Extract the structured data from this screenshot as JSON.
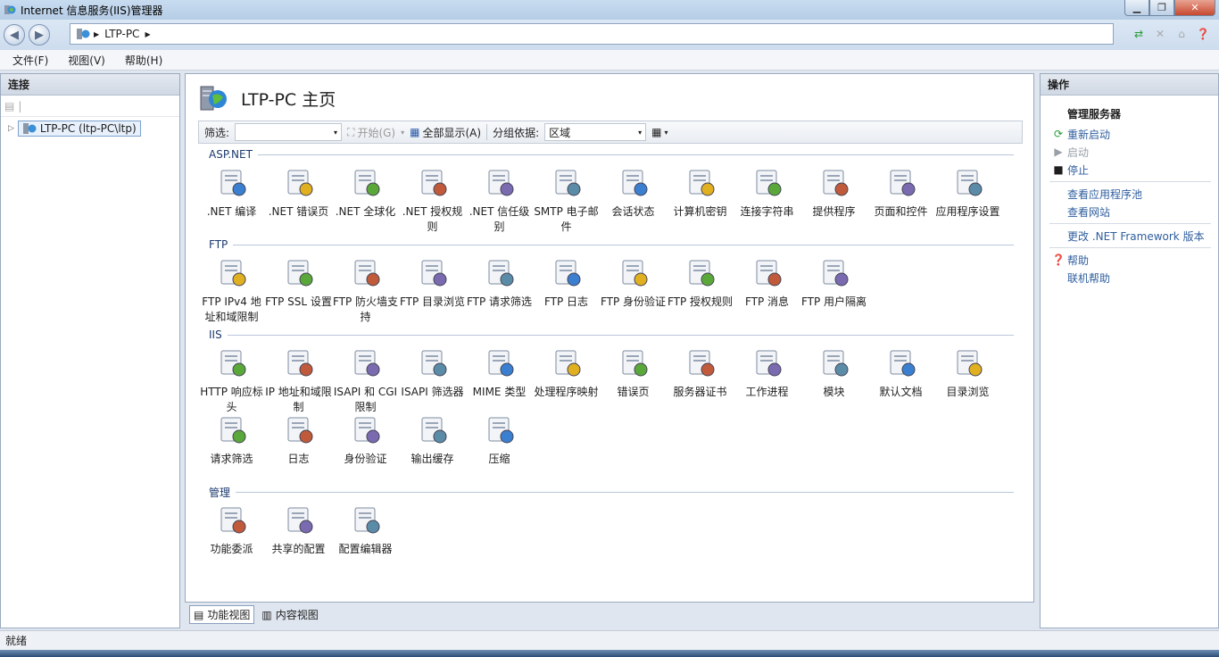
{
  "window": {
    "title": "Internet 信息服务(IIS)管理器"
  },
  "address": {
    "crumb": "LTP-PC"
  },
  "menu": [
    "文件(F)",
    "视图(V)",
    "帮助(H)"
  ],
  "left": {
    "header": "连接",
    "tree_node": "LTP-PC (ltp-PC\\ltp)"
  },
  "main": {
    "title": "LTP-PC 主页",
    "filter_label": "筛选:",
    "start_label": "开始(G)",
    "show_all_label": "全部显示(A)",
    "group_by_label": "分组依据:",
    "group_by_value": "区域",
    "sections": [
      {
        "name": "ASP.NET",
        "items": [
          ".NET 编译",
          ".NET 错误页",
          ".NET 全球化",
          ".NET 授权规则",
          ".NET 信任级别",
          "SMTP 电子邮件",
          "会话状态",
          "计算机密钥",
          "连接字符串",
          "提供程序",
          "页面和控件",
          "应用程序设置"
        ]
      },
      {
        "name": "FTP",
        "items": [
          "FTP IPv4 地址和域限制",
          "FTP SSL 设置",
          "FTP 防火墙支持",
          "FTP 目录浏览",
          "FTP 请求筛选",
          "FTP 日志",
          "FTP 身份验证",
          "FTP 授权规则",
          "FTP 消息",
          "FTP 用户隔离"
        ]
      },
      {
        "name": "IIS",
        "items": [
          "HTTP 响应标头",
          "IP 地址和域限制",
          "ISAPI 和 CGI 限制",
          "ISAPI 筛选器",
          "MIME 类型",
          "处理程序映射",
          "错误页",
          "服务器证书",
          "工作进程",
          "模块",
          "默认文档",
          "目录浏览",
          "请求筛选",
          "日志",
          "身份验证",
          "输出缓存",
          "压缩"
        ]
      },
      {
        "name": "管理",
        "items": [
          "功能委派",
          "共享的配置",
          "配置编辑器"
        ]
      }
    ],
    "tabs": [
      "功能视图",
      "内容视图"
    ]
  },
  "right": {
    "header": "操作",
    "group_title": "管理服务器",
    "actions": [
      {
        "label": "重新启动",
        "enabled": true,
        "icon": "restart-icon"
      },
      {
        "label": "启动",
        "enabled": false,
        "icon": "start-icon"
      },
      {
        "label": "停止",
        "enabled": true,
        "icon": "stop-icon"
      }
    ],
    "links1": [
      "查看应用程序池",
      "查看网站"
    ],
    "links2": [
      "更改 .NET Framework 版本"
    ],
    "help": [
      "帮助",
      "联机帮助"
    ]
  },
  "status": {
    "text": "就绪"
  }
}
